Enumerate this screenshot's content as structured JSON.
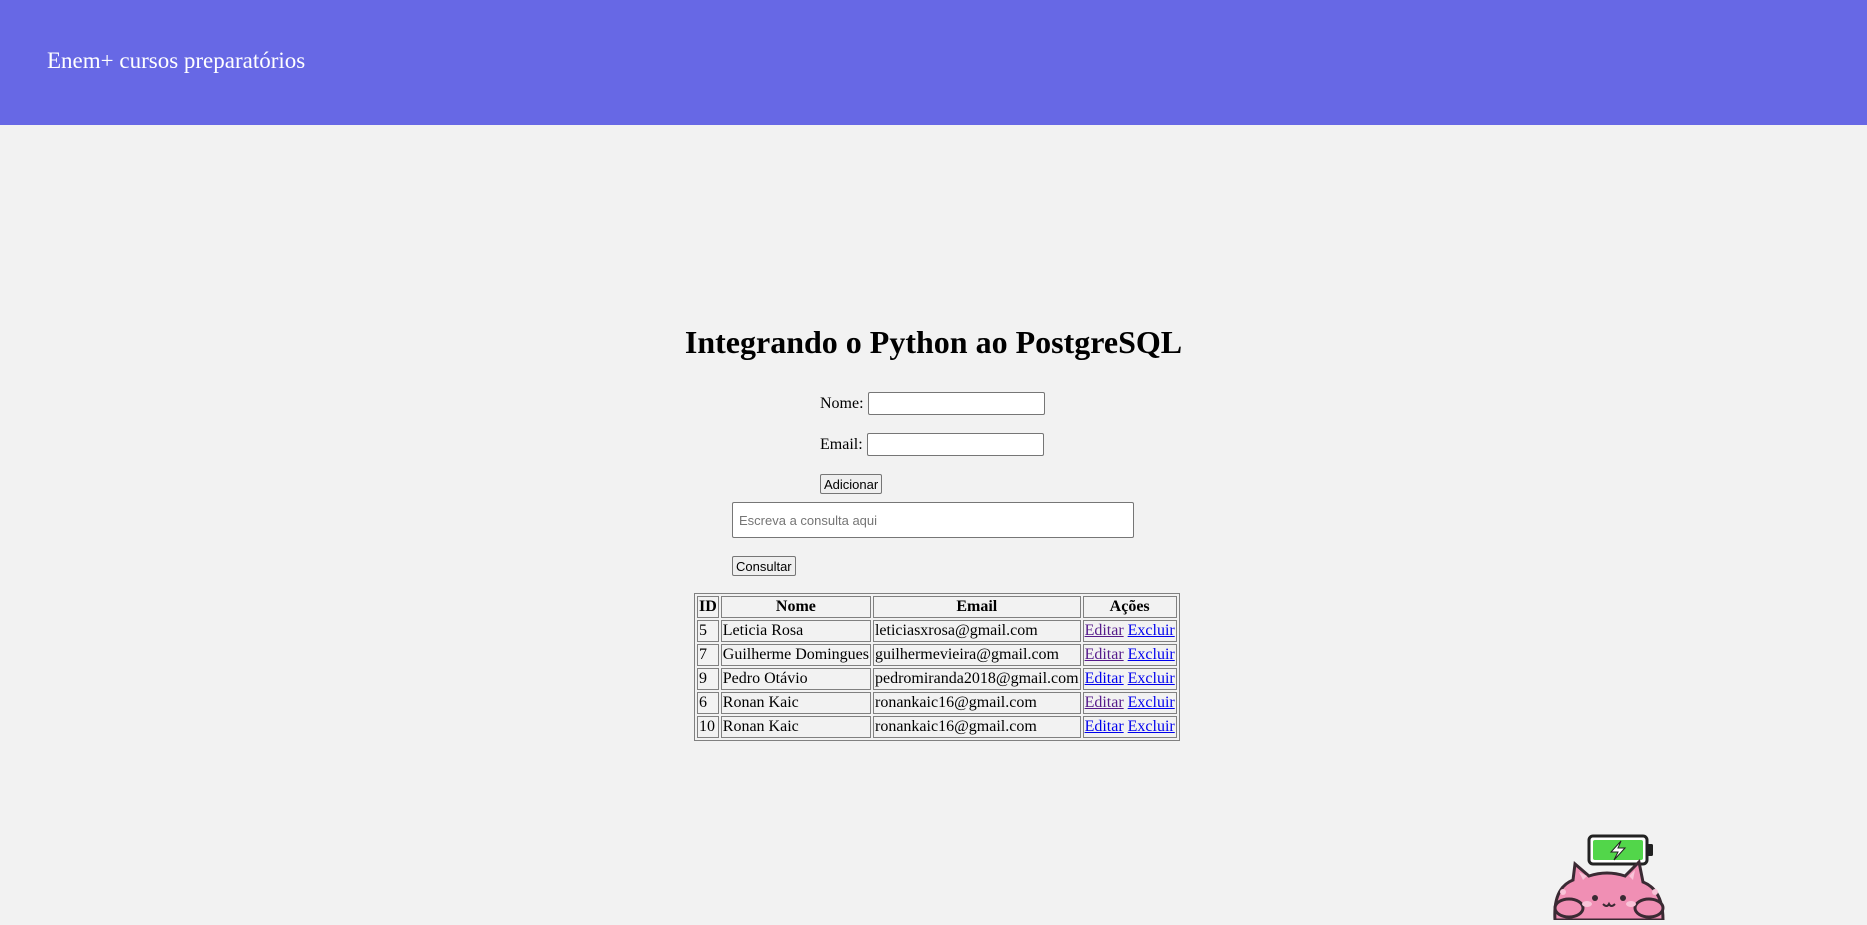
{
  "header": {
    "brand": "Enem+ cursos preparatórios"
  },
  "main": {
    "title": "Integrando o Python ao PostgreSQL",
    "form": {
      "name_label": "Nome:",
      "name_value": "",
      "email_label": "Email:",
      "email_value": "",
      "add_button": "Adicionar"
    },
    "query": {
      "placeholder": "Escreva a consulta aqui",
      "value": "",
      "submit_button": "Consultar"
    },
    "table": {
      "headers": [
        "ID",
        "Nome",
        "Email",
        "Ações"
      ],
      "rows": [
        {
          "id": "5",
          "name": "Leticia Rosa",
          "email": "leticiasxrosa@gmail.com",
          "edit": "Editar",
          "delete": "Excluir",
          "edit_visited": true
        },
        {
          "id": "7",
          "name": "Guilherme Domingues",
          "email": "guilhermevieira@gmail.com",
          "edit": "Editar",
          "delete": "Excluir",
          "edit_visited": true
        },
        {
          "id": "9",
          "name": "Pedro Otávio",
          "email": "pedromiranda2018@gmail.com",
          "edit": "Editar",
          "delete": "Excluir",
          "edit_visited": false
        },
        {
          "id": "6",
          "name": "Ronan Kaic",
          "email": "ronankaic16@gmail.com",
          "edit": "Editar",
          "delete": "Excluir",
          "edit_visited": true
        },
        {
          "id": "10",
          "name": "Ronan Kaic",
          "email": "ronankaic16@gmail.com",
          "edit": "Editar",
          "delete": "Excluir",
          "edit_visited": false
        }
      ]
    }
  },
  "colors": {
    "header_bg": "#6768e5",
    "page_bg": "#f2f2f2",
    "link": "#0000ee",
    "visited_link": "#551a8b"
  },
  "overlay": {
    "icon": "battery-charging-icon",
    "mascot": "pink-cat-mascot"
  }
}
